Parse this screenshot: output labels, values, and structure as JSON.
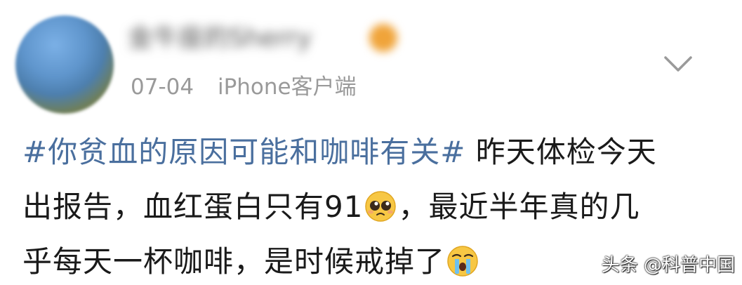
{
  "user": {
    "name_blurred": "金牛座的Sherry",
    "avatar": "avatar-image"
  },
  "meta": {
    "date": "07-04",
    "client": "iPhone客户端"
  },
  "post": {
    "topic": "#你贫血的原因可能和咖啡有关#",
    "line1_after_topic": " 昨天体检今天",
    "line2_before_emoji": "出报告，血红蛋白只有91",
    "line2_after_emoji": "，最近半年真的几",
    "line3_before_emoji": "乎每天一杯咖啡，是时候戒掉了",
    "emoji1": "pleading-face-emoji",
    "emoji2": "loudly-crying-face-emoji"
  },
  "icons": {
    "expand": "chevron-down-icon"
  },
  "watermark": {
    "text": "头条 @科普中国"
  },
  "colors": {
    "topic": "#4a6f9e",
    "meta": "#9a9a9a",
    "text": "#1a1a1a"
  }
}
